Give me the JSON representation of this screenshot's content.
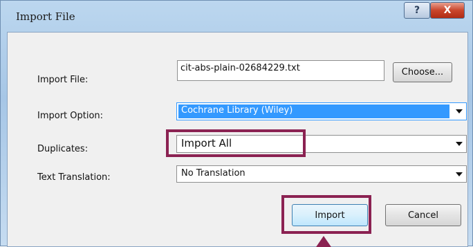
{
  "window": {
    "title": "Import File",
    "help_label": "?",
    "close_label": "X"
  },
  "form": {
    "import_file_label": "Import File:",
    "import_file_value": "cit-abs-plain-02684229.txt",
    "choose_label": "Choose...",
    "import_option_label": "Import Option:",
    "import_option_value": "Cochrane Library (Wiley)",
    "duplicates_label": "Duplicates:",
    "duplicates_value": "Import All",
    "text_translation_label": "Text Translation:",
    "text_translation_value": "No Translation"
  },
  "actions": {
    "import_label": "Import",
    "cancel_label": "Cancel"
  },
  "annotation": {
    "highlight_color": "#8b2252"
  }
}
